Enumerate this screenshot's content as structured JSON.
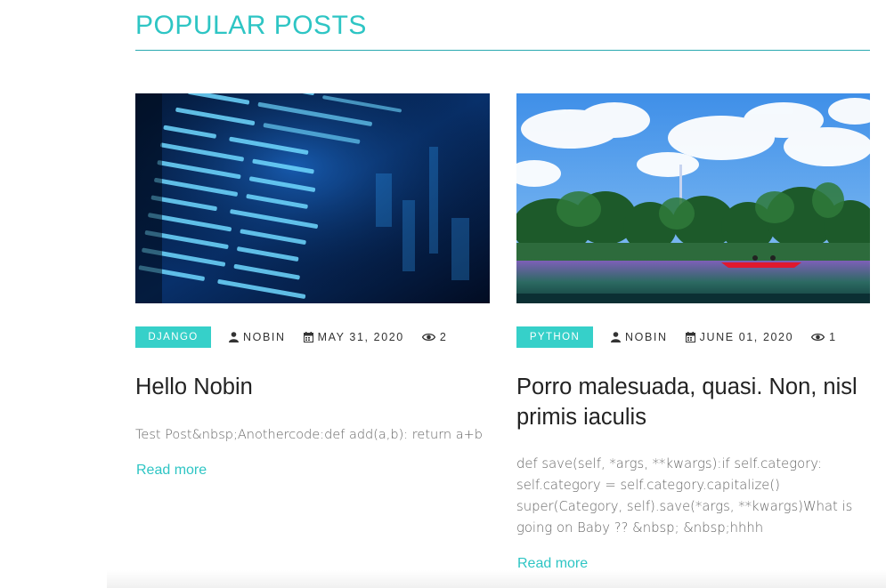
{
  "section": {
    "title": "POPULAR POSTS"
  },
  "posts": [
    {
      "category": "DJANGO",
      "author": "NOBIN",
      "date": "MAY 31, 2020",
      "views": "2",
      "title": "Hello Nobin",
      "excerpt": "Test Post&nbsp;Anothercode:def add(a,b): return a+b",
      "read_more": "Read more",
      "image": "code-screen-image"
    },
    {
      "category": "PYTHON",
      "author": "NOBIN",
      "date": "JUNE 01, 2020",
      "views": "1",
      "title": "Porro malesuada, quasi. Non, nisl primis iaculis",
      "excerpt": "def save(self, *args, **kwargs):if self.category: self.category = self.category.capitalize() super(Category, self).save(*args, **kwargs)What is going on Baby ?? &nbsp; &nbsp;hhhh",
      "read_more": "Read more",
      "image": "lake-landscape-image"
    }
  ],
  "icons": {
    "author": "user-icon",
    "date": "calendar-icon",
    "views": "eye-icon"
  },
  "colors": {
    "accent": "#2ec5c4",
    "category_bg": "#36d0c9",
    "rule": "#2aa9b0"
  }
}
